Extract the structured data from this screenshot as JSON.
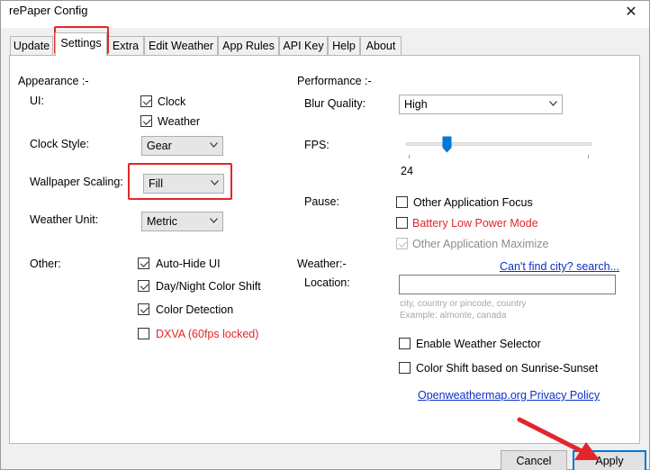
{
  "window": {
    "title": "rePaper Config",
    "close_glyph": "✕"
  },
  "tabs": [
    {
      "label": "Update"
    },
    {
      "label": "Settings"
    },
    {
      "label": "Extra"
    },
    {
      "label": "Edit Weather"
    },
    {
      "label": "App Rules"
    },
    {
      "label": "API Key"
    },
    {
      "label": "Help"
    },
    {
      "label": "About"
    }
  ],
  "active_tab": "Settings",
  "appearance": {
    "heading": "Appearance :-",
    "ui_label": "UI:",
    "ui_options": [
      {
        "label": "Clock",
        "checked": true
      },
      {
        "label": "Weather",
        "checked": true
      }
    ],
    "clock_style_label": "Clock Style:",
    "clock_style_value": "Gear",
    "wallpaper_scaling_label": "Wallpaper Scaling:",
    "wallpaper_scaling_value": "Fill",
    "weather_unit_label": "Weather Unit:",
    "weather_unit_value": "Metric",
    "other_label": "Other:",
    "other_options": [
      {
        "label": "Auto-Hide UI",
        "checked": true
      },
      {
        "label": "Day/Night Color Shift",
        "checked": true
      },
      {
        "label": "Color Detection",
        "checked": true
      },
      {
        "label": "DXVA (60fps locked)",
        "checked": false
      }
    ]
  },
  "performance": {
    "heading": "Performance :-",
    "blur_quality_label": "Blur Quality:",
    "blur_quality_value": "High",
    "fps_label": "FPS:",
    "fps_value": "24",
    "fps_level": 0.1,
    "pause_label": "Pause:",
    "pause_options": [
      {
        "label": "Other Application Focus",
        "checked": false
      },
      {
        "label": "Battery Low Power Mode",
        "checked": false
      },
      {
        "label": "Other Application Maximize",
        "checked": true,
        "disabled": true
      }
    ]
  },
  "weather": {
    "heading": "Weather:-",
    "cant_find_link": "Can't find city? search...",
    "location_label": "Location:",
    "location_value": "",
    "hint_line1": "city, country or pincode, country",
    "hint_line2": "Example: almonte, canada",
    "enable_selector_label": "Enable Weather Selector",
    "enable_selector_checked": false,
    "color_shift_label": "Color Shift based on Sunrise-Sunset",
    "color_shift_checked": false,
    "privacy_link": "Openweathermap.org Privacy Policy"
  },
  "buttons": {
    "cancel": "Cancel",
    "apply": "Apply"
  },
  "colors": {
    "highlight": "#e3262b",
    "link": "#0a30c8",
    "warning_text": "#e3262b",
    "accent": "#0078d7"
  }
}
